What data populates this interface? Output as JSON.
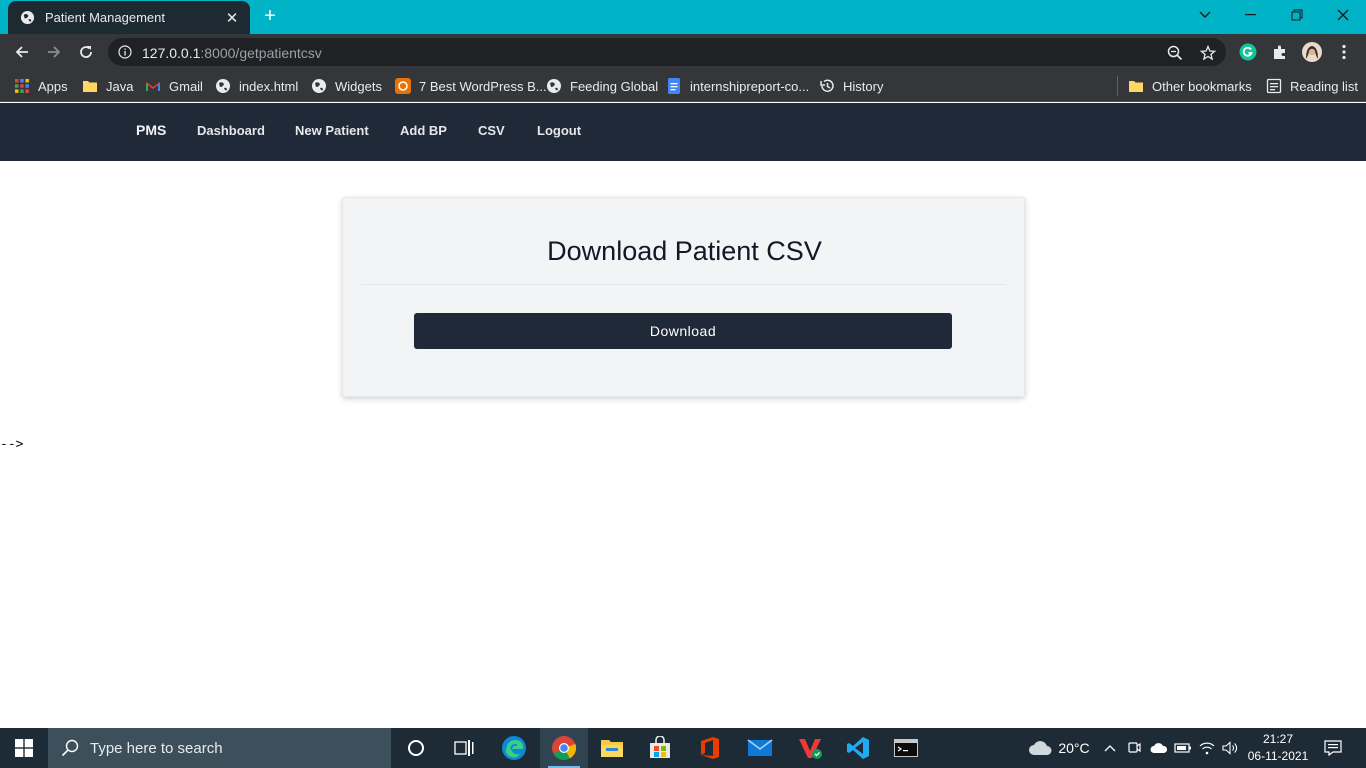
{
  "browser": {
    "tab": {
      "title": "Patient Management",
      "close_glyph": "✕"
    },
    "new_tab_glyph": "+",
    "address": {
      "host": "127.0.0.1",
      "path": ":8000/getpatientcsv"
    },
    "bookmarks": [
      {
        "label": "Apps",
        "icon": "apps-grid-icon"
      },
      {
        "label": "Java",
        "icon": "folder-icon"
      },
      {
        "label": "Gmail",
        "icon": "gmail-icon"
      },
      {
        "label": "index.html",
        "icon": "globe-icon"
      },
      {
        "label": "Widgets",
        "icon": "globe-icon"
      },
      {
        "label": "7 Best WordPress B...",
        "icon": "site-icon"
      },
      {
        "label": "Feeding Global",
        "icon": "globe-icon"
      },
      {
        "label": "internshipreport-co...",
        "icon": "docs-icon"
      },
      {
        "label": "History",
        "icon": "history-icon"
      }
    ],
    "other_bookmarks": "Other bookmarks",
    "reading_list": "Reading list"
  },
  "site": {
    "nav": {
      "brand": "PMS",
      "links": [
        "Dashboard",
        "New Patient",
        "Add BP",
        "CSV",
        "Logout"
      ]
    },
    "card": {
      "title": "Download Patient CSV",
      "button_label": "Download"
    },
    "stray_text": "-->"
  },
  "taskbar": {
    "search_placeholder": "Type here to search",
    "weather": "20°C",
    "time": "21:27",
    "date": "06-11-2021"
  },
  "colors": {
    "tab_strip": "#00b3c6",
    "navbar": "#1f2937",
    "card_bg": "#f3f4f6",
    "button": "#1f2937"
  }
}
